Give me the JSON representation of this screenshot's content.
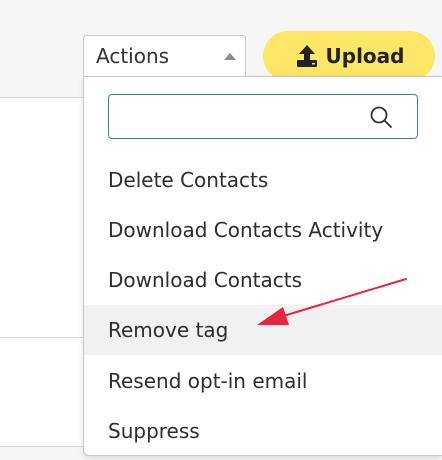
{
  "toolbar": {
    "actions_label": "Actions",
    "upload_label": "Upload"
  },
  "dropdown": {
    "search": {
      "value": "",
      "placeholder": ""
    },
    "items": [
      {
        "label": "Delete Contacts",
        "highlighted": false
      },
      {
        "label": "Download Contacts Activity",
        "highlighted": false
      },
      {
        "label": "Download Contacts",
        "highlighted": false
      },
      {
        "label": "Remove tag",
        "highlighted": true
      },
      {
        "label": "Resend opt-in email",
        "highlighted": false
      },
      {
        "label": "Suppress",
        "highlighted": false
      }
    ]
  },
  "colors": {
    "upload_button": "#fde565",
    "search_border": "#3d8a8c",
    "annotation_arrow": "#e8243c",
    "highlight_row": "#f1f1f4"
  },
  "icons": {
    "upload": "upload-icon",
    "search": "search-icon",
    "caret": "caret-up-icon",
    "annotation": "red-arrow-annotation"
  }
}
